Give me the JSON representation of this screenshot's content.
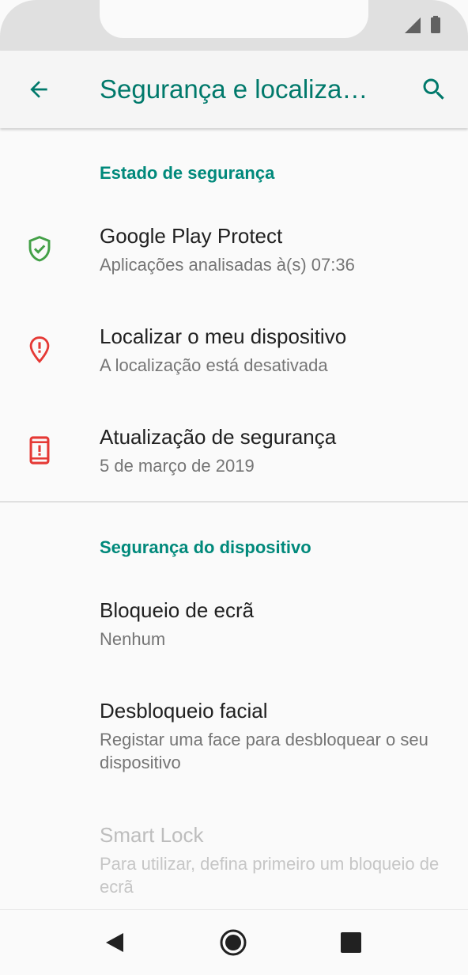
{
  "appbar": {
    "title": "Segurança e localiza…",
    "back_icon": "arrow-back-icon",
    "search_icon": "search-icon"
  },
  "sections": [
    {
      "header": "Estado de segurança",
      "items": [
        {
          "title": "Google Play Protect",
          "subtitle": "Aplicações analisadas à(s) 07:36",
          "icon": "shield-check-icon",
          "icon_color": "#43a047"
        },
        {
          "title": "Localizar o meu dispositivo",
          "subtitle": "A localização está desativada",
          "icon": "location-alert-icon",
          "icon_color": "#e53935"
        },
        {
          "title": "Atualização de segurança",
          "subtitle": "5 de março de 2019",
          "icon": "phone-alert-icon",
          "icon_color": "#e53935"
        }
      ]
    },
    {
      "header": "Segurança do dispositivo",
      "items": [
        {
          "title": "Bloqueio de ecrã",
          "subtitle": "Nenhum"
        },
        {
          "title": "Desbloqueio facial",
          "subtitle": "Registar uma face para desbloquear o seu dispositivo"
        },
        {
          "title": "Smart Lock",
          "subtitle": "Para utilizar, defina primeiro um bloqueio de ecrã",
          "disabled": true
        }
      ]
    }
  ],
  "colors": {
    "accent": "#00796b",
    "section_header": "#00897b",
    "primary_text": "#212121",
    "secondary_text": "#757575"
  },
  "navbar": {
    "back_icon": "nav-back-icon",
    "home_icon": "nav-home-icon",
    "recents_icon": "nav-recents-icon"
  }
}
